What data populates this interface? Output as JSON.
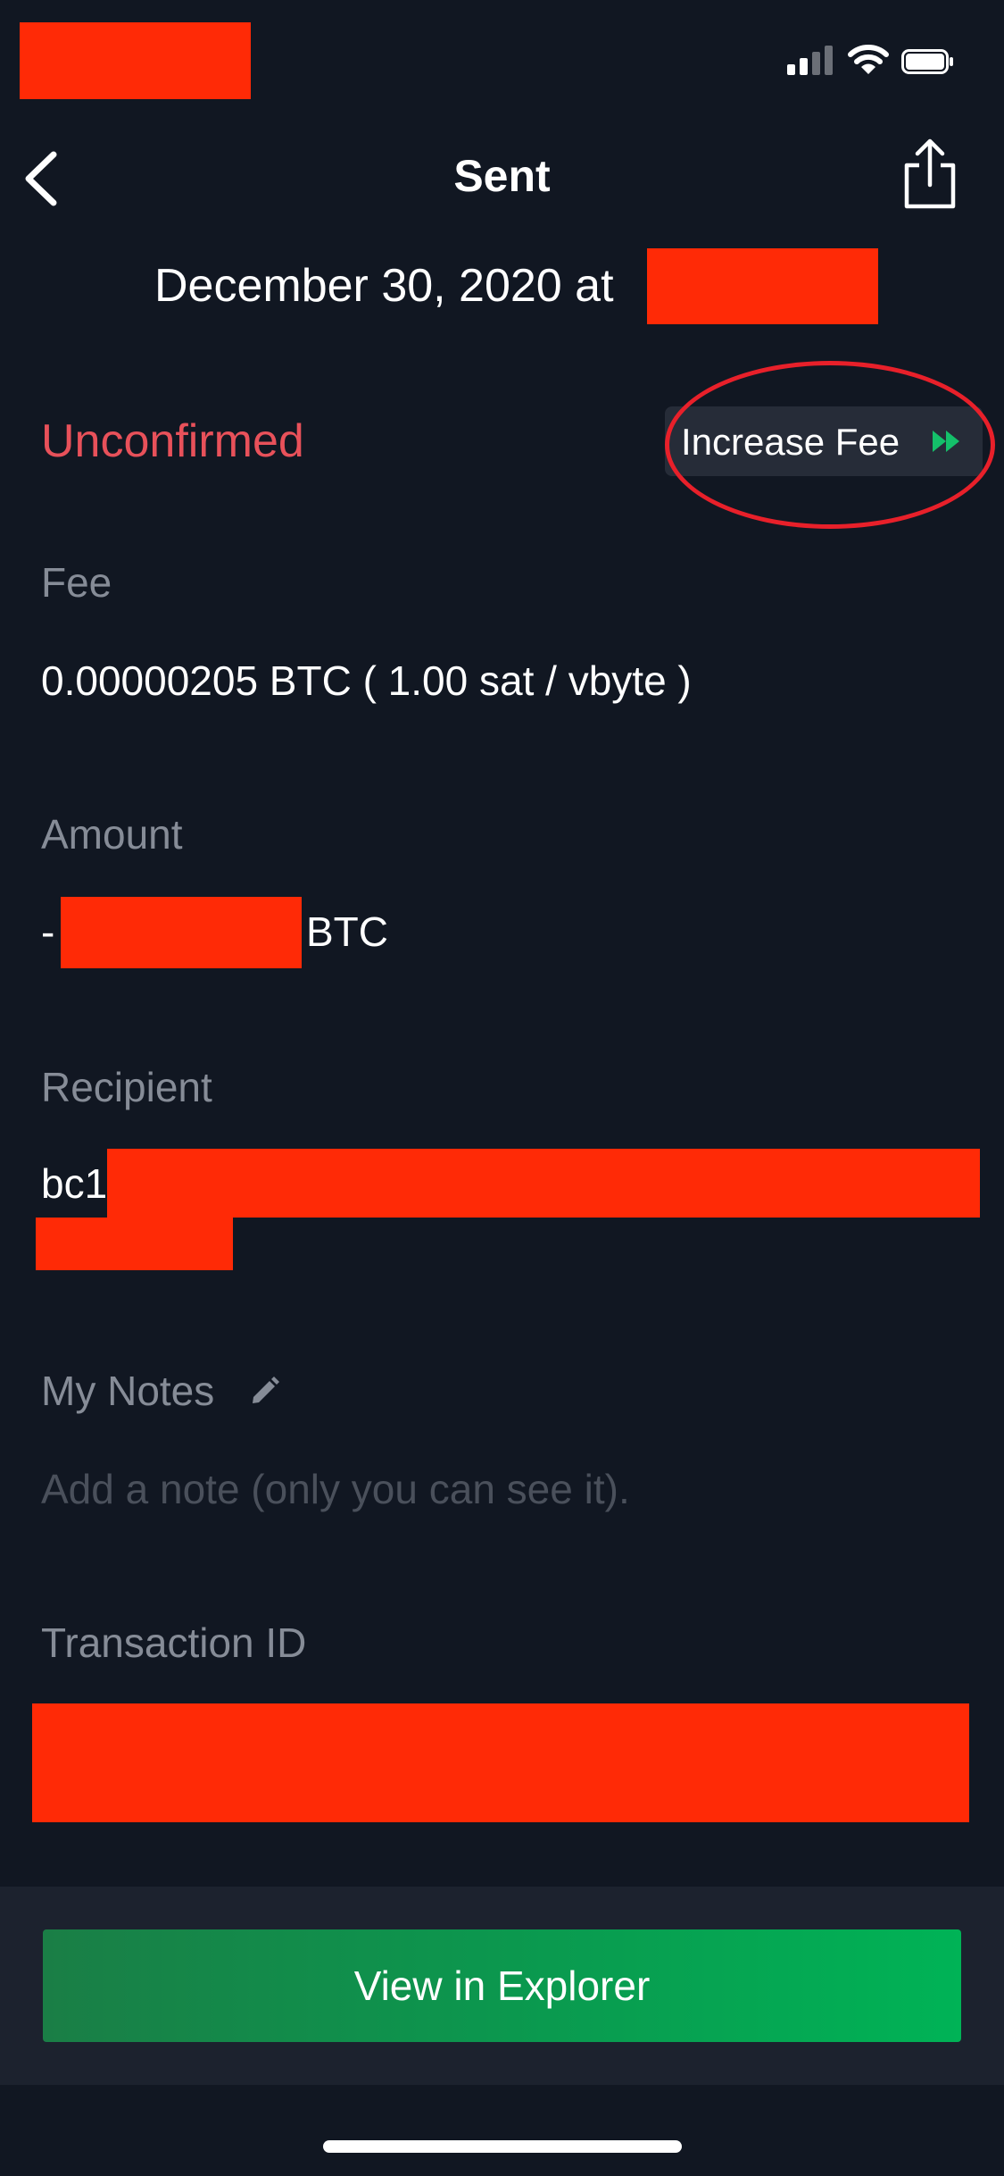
{
  "status_bar": {
    "icons": [
      "signal-icon",
      "wifi-icon",
      "battery-icon"
    ]
  },
  "nav": {
    "title": "Sent",
    "back_icon": "chevron-left-icon",
    "share_icon": "share-icon"
  },
  "date": {
    "text": "December 30, 2020 at"
  },
  "status": {
    "label": "Unconfirmed",
    "color": "#e8515a"
  },
  "increase_fee": {
    "label": "Increase Fee",
    "icon": "fast-forward-icon",
    "accent": "#14c06a"
  },
  "fee": {
    "label": "Fee",
    "value": "0.00000205 BTC ( 1.00 sat / vbyte )"
  },
  "amount": {
    "label": "Amount",
    "prefix": "-",
    "unit": "BTC"
  },
  "recipient": {
    "label": "Recipient",
    "prefix": "bc1"
  },
  "notes": {
    "label": "My Notes",
    "icon": "pencil-icon",
    "placeholder": "Add a note (only you can see it)."
  },
  "transaction_id": {
    "label": "Transaction ID"
  },
  "footer": {
    "button_label": "View in Explorer"
  },
  "colors": {
    "background": "#111722",
    "redaction": "#ff2a06",
    "button_green": "#00b356"
  }
}
